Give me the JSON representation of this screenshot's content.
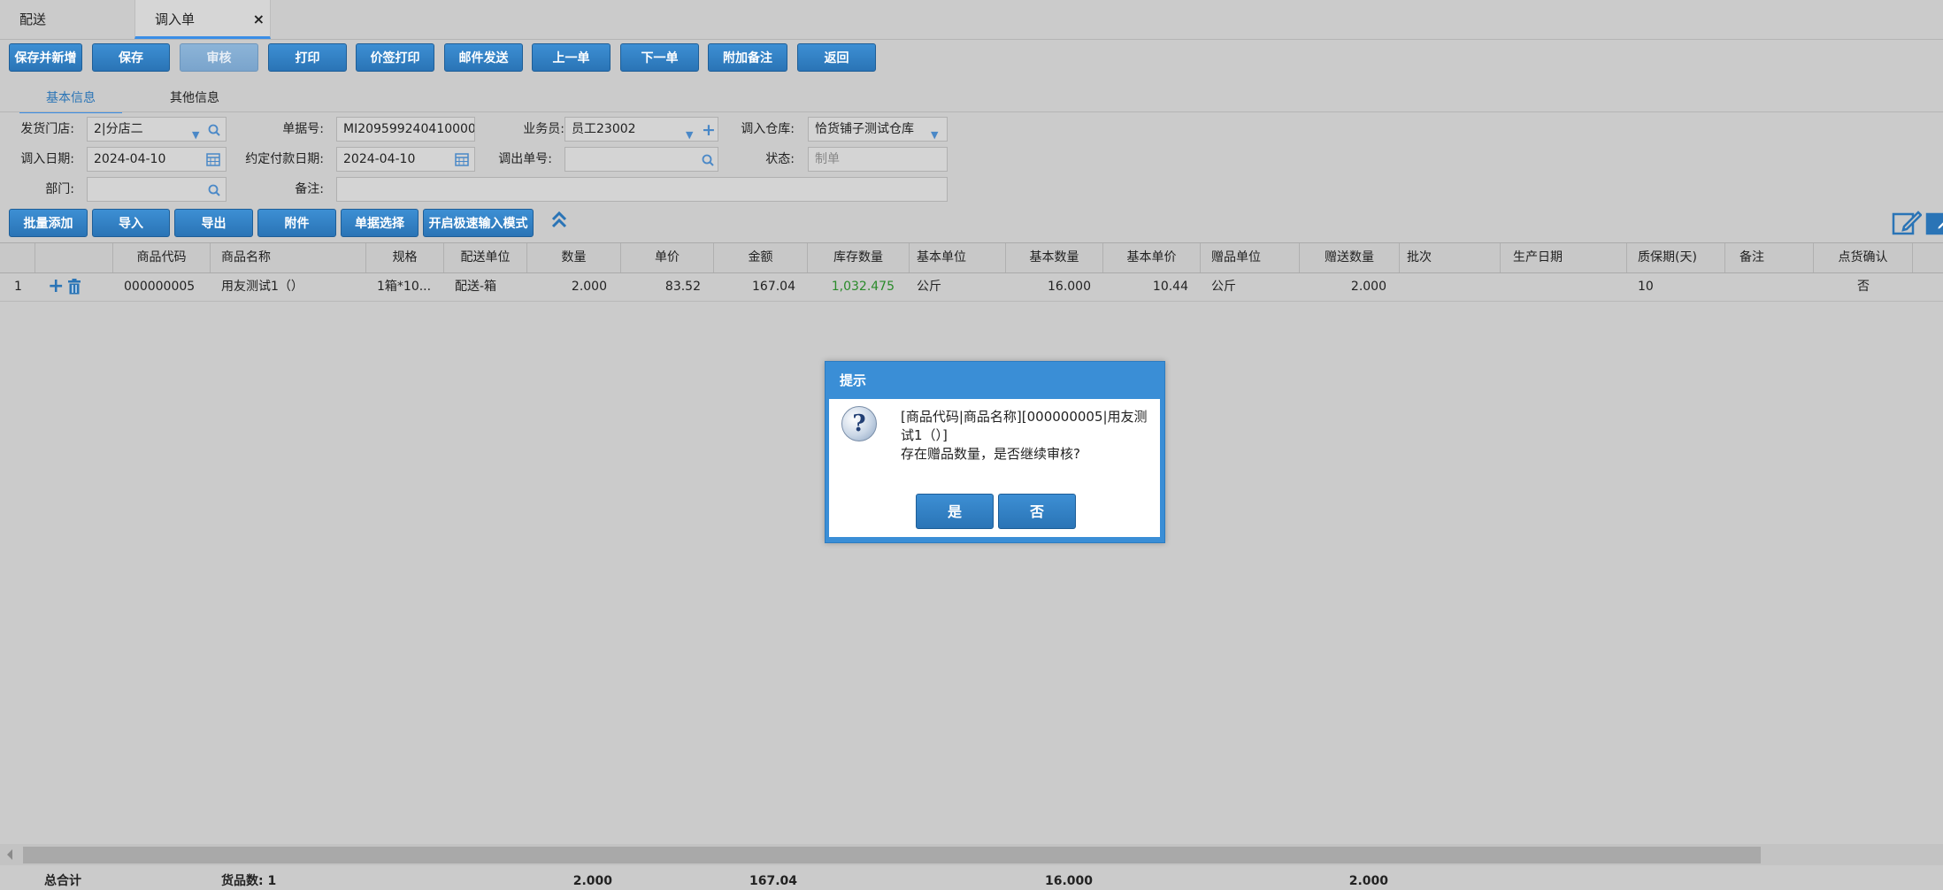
{
  "tabs": [
    {
      "label": "配送"
    },
    {
      "label": "调入单",
      "close": "×"
    }
  ],
  "toolbar": {
    "buttons": [
      "保存并新增",
      "保存",
      "审核",
      "打印",
      "价签打印",
      "邮件发送",
      "上一单",
      "下一单",
      "附加备注",
      "返回"
    ]
  },
  "subtabs": [
    "基本信息",
    "其他信息"
  ],
  "form": {
    "send_store_label": "发货门店:",
    "send_store_value": "2|分店二",
    "doc_no_label": "单据号:",
    "doc_no_value": "MI209599240410000",
    "clerk_label": "业务员:",
    "clerk_value": "员工23002",
    "in_wh_label": "调入仓库:",
    "in_wh_value": "恰货铺子测试仓库",
    "in_date_label": "调入日期:",
    "in_date_value": "2024-04-10",
    "pay_date_label": "约定付款日期:",
    "pay_date_value": "2024-04-10",
    "out_no_label": "调出单号:",
    "out_no_value": "",
    "status_label": "状态:",
    "status_value": "制单",
    "dept_label": "部门:",
    "dept_value": "",
    "remark_label": "备注:",
    "remark_value": ""
  },
  "grid_toolbar": {
    "buttons": [
      "批量添加",
      "导入",
      "导出",
      "附件",
      "单据选择",
      "开启极速输入模式"
    ]
  },
  "grid": {
    "columns": [
      "商品代码",
      "商品名称",
      "规格",
      "配送单位",
      "数量",
      "单价",
      "金额",
      "库存数量",
      "基本单位",
      "基本数量",
      "基本单价",
      "赠品单位",
      "赠送数量",
      "批次",
      "生产日期",
      "质保期(天)",
      "备注",
      "点货确认"
    ],
    "rows": [
      {
        "idx": "1",
        "code": "000000005",
        "name": "用友测试1（）",
        "spec": "1箱*10...",
        "unit": "配送-箱",
        "qty": "2.000",
        "price": "83.52",
        "amount": "167.04",
        "stock": "1,032.475",
        "base_unit": "公斤",
        "base_qty": "16.000",
        "base_price": "10.44",
        "gift_unit": "公斤",
        "gift_qty": "2.000",
        "batch": "",
        "prod_date": "",
        "warranty": "10",
        "remark": "",
        "check": "否"
      }
    ]
  },
  "footer": {
    "total_label": "总合计",
    "goods_count": "货品数: 1",
    "qty": "2.000",
    "amount": "167.04",
    "base_qty": "16.000",
    "gift_qty": "2.000"
  },
  "dialog": {
    "title": "提示",
    "line1": "[商品代码|商品名称][000000005|用友测试1（）]",
    "line2": "存在赠品数量，是否继续审核?",
    "yes": "是",
    "no": "否"
  },
  "colors": {
    "accent": "#2a74b6",
    "stock_green": "#2a8a2a"
  }
}
